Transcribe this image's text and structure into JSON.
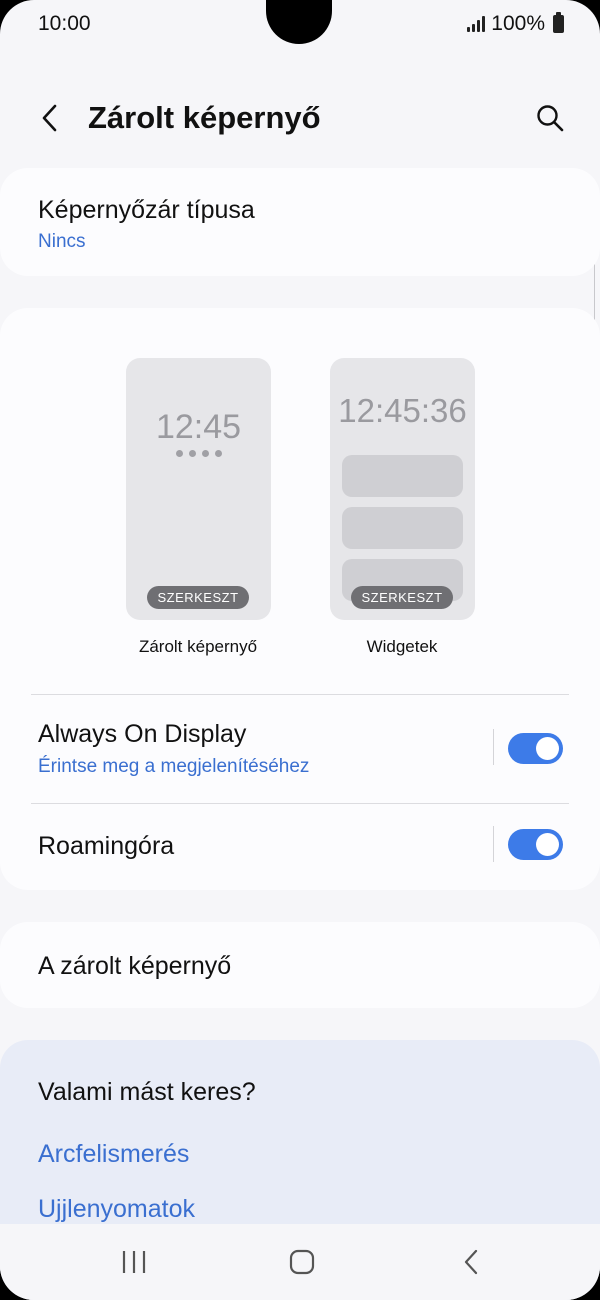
{
  "status_bar": {
    "time": "10:00",
    "battery": "100%"
  },
  "header": {
    "title": "Zárolt képernyő"
  },
  "lock_type": {
    "title": "Képernyőzár típusa",
    "value": "Nincs"
  },
  "previews": {
    "lock": {
      "clock": "12:45",
      "edit": "SZERKESZT",
      "label": "Zárolt képernyő"
    },
    "widget": {
      "clock": "12:45:36",
      "edit": "SZERKESZT",
      "label": "Widgetek"
    }
  },
  "settings": {
    "aod": {
      "title": "Always On Display",
      "subtitle": "Érintse meg a megjelenítéséhez",
      "enabled": true
    },
    "roaming": {
      "title": "Roamingóra",
      "enabled": true
    }
  },
  "lock_info": {
    "title": "A zárolt képernyő"
  },
  "suggestions": {
    "title": "Valami mást keres?",
    "links": [
      "Arcfelismerés",
      "Ujjlenyomatok"
    ]
  },
  "colors": {
    "accent": "#3d7be8",
    "link": "#3a6fd0",
    "background": "#f6f6f9",
    "card": "#fcfcfe",
    "suggest_bg": "#e8ecf7"
  },
  "icons": {
    "back": "chevron-left-icon",
    "search": "search-icon",
    "nav_recents": "recents-icon",
    "nav_home": "home-icon",
    "nav_back": "back-icon"
  }
}
